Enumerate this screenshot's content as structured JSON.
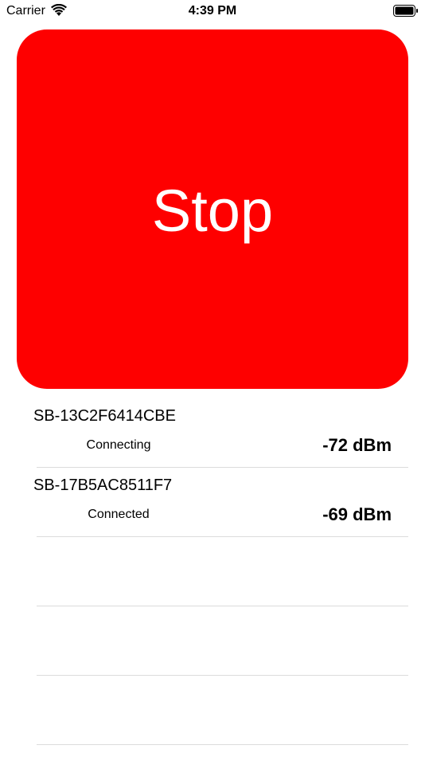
{
  "status_bar": {
    "carrier": "Carrier",
    "time": "4:39 PM",
    "wifi_icon": "wifi-icon",
    "battery_icon": "battery-icon"
  },
  "stop_button": {
    "label": "Stop",
    "color": "#fe0000"
  },
  "devices": [
    {
      "name": "SB-13C2F6414CBE",
      "status": "Connecting",
      "rssi": "-72 dBm"
    },
    {
      "name": "SB-17B5AC8511F7",
      "status": "Connected",
      "rssi": "-69 dBm"
    }
  ]
}
